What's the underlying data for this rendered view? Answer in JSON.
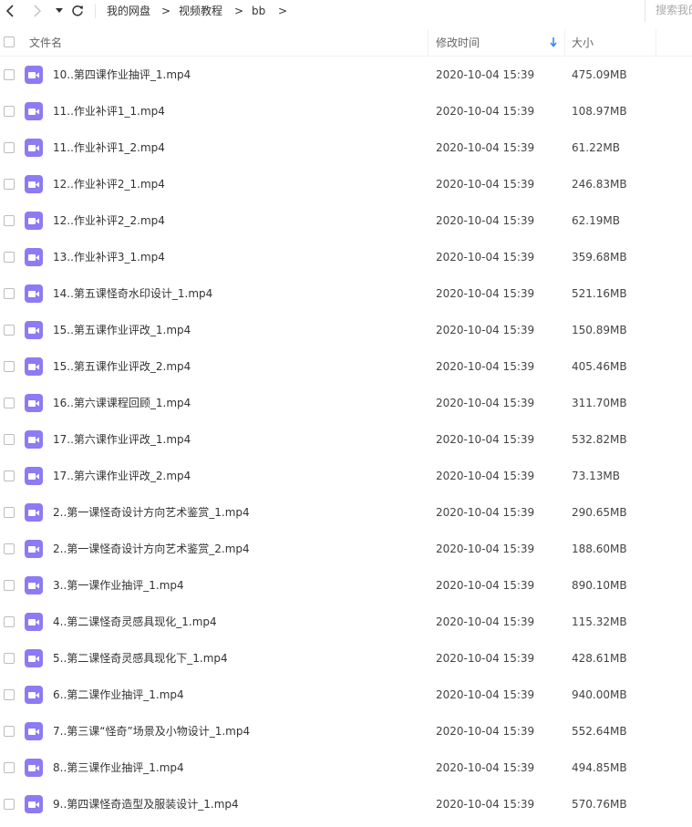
{
  "toolbar": {
    "back_icon": "chevron-left-icon",
    "forward_icon": "chevron-right-icon",
    "history_icon": "caret-down-icon",
    "refresh_icon": "refresh-icon",
    "breadcrumbs": [
      "我的网盘",
      "视频教程",
      "bb"
    ],
    "breadcrumb_separator": ">",
    "search_placeholder": "搜索我的网盘文件"
  },
  "header": {
    "name_label": "文件名",
    "modified_label": "修改时间",
    "size_label": "大小",
    "sort_icon": "arrow-down-icon",
    "sort_color": "#2a8cff"
  },
  "colors": {
    "video_icon_bg": "#8c7bf4"
  },
  "files": [
    {
      "name": "10..第四课作业抽评_1.mp4",
      "modified": "2020-10-04 15:39",
      "size": "475.09MB"
    },
    {
      "name": "11..作业补评1_1.mp4",
      "modified": "2020-10-04 15:39",
      "size": "108.97MB"
    },
    {
      "name": "11..作业补评1_2.mp4",
      "modified": "2020-10-04 15:39",
      "size": "61.22MB"
    },
    {
      "name": "12..作业补评2_1.mp4",
      "modified": "2020-10-04 15:39",
      "size": "246.83MB"
    },
    {
      "name": "12..作业补评2_2.mp4",
      "modified": "2020-10-04 15:39",
      "size": "62.19MB"
    },
    {
      "name": "13..作业补评3_1.mp4",
      "modified": "2020-10-04 15:39",
      "size": "359.68MB"
    },
    {
      "name": "14..第五课怪奇水印设计_1.mp4",
      "modified": "2020-10-04 15:39",
      "size": "521.16MB"
    },
    {
      "name": "15..第五课作业评改_1.mp4",
      "modified": "2020-10-04 15:39",
      "size": "150.89MB"
    },
    {
      "name": "15..第五课作业评改_2.mp4",
      "modified": "2020-10-04 15:39",
      "size": "405.46MB"
    },
    {
      "name": "16..第六课课程回顾_1.mp4",
      "modified": "2020-10-04 15:39",
      "size": "311.70MB"
    },
    {
      "name": "17..第六课作业评改_1.mp4",
      "modified": "2020-10-04 15:39",
      "size": "532.82MB"
    },
    {
      "name": "17..第六课作业评改_2.mp4",
      "modified": "2020-10-04 15:39",
      "size": "73.13MB"
    },
    {
      "name": "2..第一课怪奇设计方向艺术鉴赏_1.mp4",
      "modified": "2020-10-04 15:39",
      "size": "290.65MB"
    },
    {
      "name": "2..第一课怪奇设计方向艺术鉴赏_2.mp4",
      "modified": "2020-10-04 15:39",
      "size": "188.60MB"
    },
    {
      "name": "3..第一课作业抽评_1.mp4",
      "modified": "2020-10-04 15:39",
      "size": "890.10MB"
    },
    {
      "name": "4..第二课怪奇灵感具现化_1.mp4",
      "modified": "2020-10-04 15:39",
      "size": "115.32MB"
    },
    {
      "name": "5..第二课怪奇灵感具现化下_1.mp4",
      "modified": "2020-10-04 15:39",
      "size": "428.61MB"
    },
    {
      "name": "6..第二课作业抽评_1.mp4",
      "modified": "2020-10-04 15:39",
      "size": "940.00MB"
    },
    {
      "name": "7..第三课“怪奇”场景及小物设计_1.mp4",
      "modified": "2020-10-04 15:39",
      "size": "552.64MB"
    },
    {
      "name": "8..第三课作业抽评_1.mp4",
      "modified": "2020-10-04 15:39",
      "size": "494.85MB"
    },
    {
      "name": "9..第四课怪奇造型及服装设计_1.mp4",
      "modified": "2020-10-04 15:39",
      "size": "570.76MB"
    }
  ]
}
